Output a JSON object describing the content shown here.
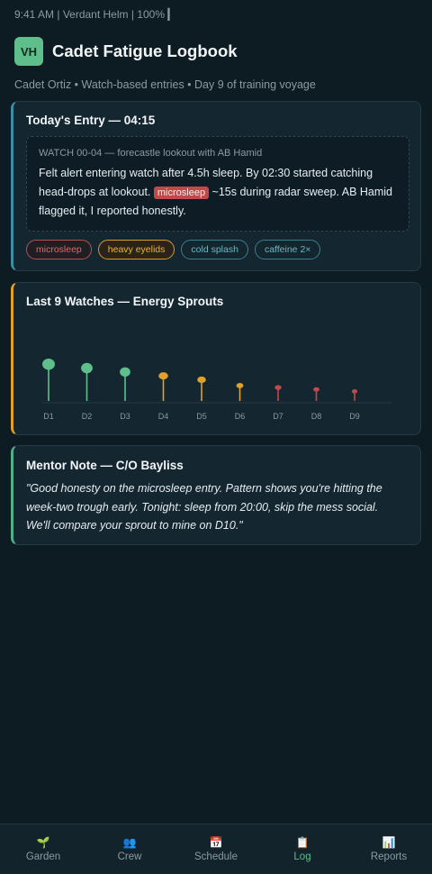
{
  "status_bar": {
    "text": "9:41 AM | Verdant Helm | 100% ▎"
  },
  "header": {
    "avatar": "VH",
    "title": "Cadet Fatigue Logbook"
  },
  "subtitle": "Cadet Ortiz • Watch-based entries • Day 9 of training voyage",
  "entry": {
    "title": "Today's Entry — 04:15",
    "meta": "WATCH 00-04 — forecastle lookout with AB Hamid",
    "text_1": "Felt alert entering watch after 4.5h sleep. By 02:30 started catching head-drops at lookout.",
    "inline_tag": "microsleep",
    "text_2": "~15s during radar sweep. AB Hamid flagged it, I reported honestly.",
    "tags": [
      {
        "label": "microsleep",
        "tone": "red"
      },
      {
        "label": "heavy eyelids",
        "tone": "amber"
      },
      {
        "label": "cold splash",
        "tone": "teal"
      },
      {
        "label": "caffeine 2×",
        "tone": "teal"
      }
    ]
  },
  "sprouts": {
    "title": "Last 9 Watches — Energy Sprouts"
  },
  "chart_data": {
    "type": "scatter",
    "title": "Last 9 Watches — Energy Sprouts",
    "categories": [
      "D1",
      "D2",
      "D3",
      "D4",
      "D5",
      "D6",
      "D7",
      "D8",
      "D9"
    ],
    "values": [
      9,
      8,
      7,
      6,
      5,
      3.5,
      3,
      2.5,
      2
    ],
    "colors": [
      "#5fbf8c",
      "#5fbf8c",
      "#5fbf8c",
      "#e0a02a",
      "#e0a02a",
      "#e0a02a",
      "#c04a4a",
      "#c04a4a",
      "#c04a4a"
    ],
    "ylim": [
      0,
      10
    ]
  },
  "mentor": {
    "title": "Mentor Note — C/O Bayliss",
    "text": "\"Good honesty on the microsleep entry. Pattern shows you're hitting the week-two trough early. Tonight: sleep from 20:00, skip the mess social. We'll compare your sprout to mine on D10.\""
  },
  "tabbar": {
    "tabs": [
      {
        "label": "Garden",
        "icon": "🌱",
        "icon_name": "sprout-icon",
        "active": false
      },
      {
        "label": "Crew",
        "icon": "👥",
        "icon_name": "people-icon",
        "active": false
      },
      {
        "label": "Schedule",
        "icon": "📅",
        "icon_name": "calendar-icon",
        "active": false
      },
      {
        "label": "Log",
        "icon": "📋",
        "icon_name": "clipboard-icon",
        "active": true
      },
      {
        "label": "Reports",
        "icon": "📊",
        "icon_name": "bar-chart-icon",
        "active": false
      }
    ]
  }
}
